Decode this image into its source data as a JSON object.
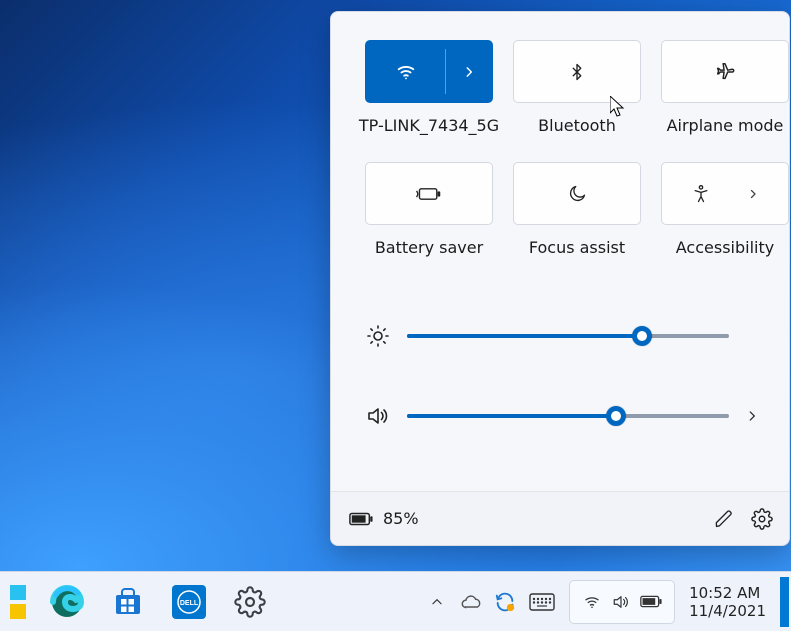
{
  "quick_settings": {
    "tiles": [
      {
        "id": "wifi",
        "label": "TP-LINK_7434_5G",
        "active": true,
        "expandable": true
      },
      {
        "id": "bluetooth",
        "label": "Bluetooth",
        "active": false,
        "expandable": false
      },
      {
        "id": "airplane",
        "label": "Airplane mode",
        "active": false,
        "expandable": false
      },
      {
        "id": "battery-saver",
        "label": "Battery saver",
        "active": false,
        "expandable": false
      },
      {
        "id": "focus-assist",
        "label": "Focus assist",
        "active": false,
        "expandable": false
      },
      {
        "id": "accessibility",
        "label": "Accessibility",
        "active": false,
        "expandable": true
      }
    ],
    "brightness_percent": 73,
    "volume_percent": 65,
    "battery_percent_text": "85%"
  },
  "taskbar": {
    "time": "10:52 AM",
    "date": "11/4/2021"
  },
  "colors": {
    "accent": "#0067c0"
  }
}
